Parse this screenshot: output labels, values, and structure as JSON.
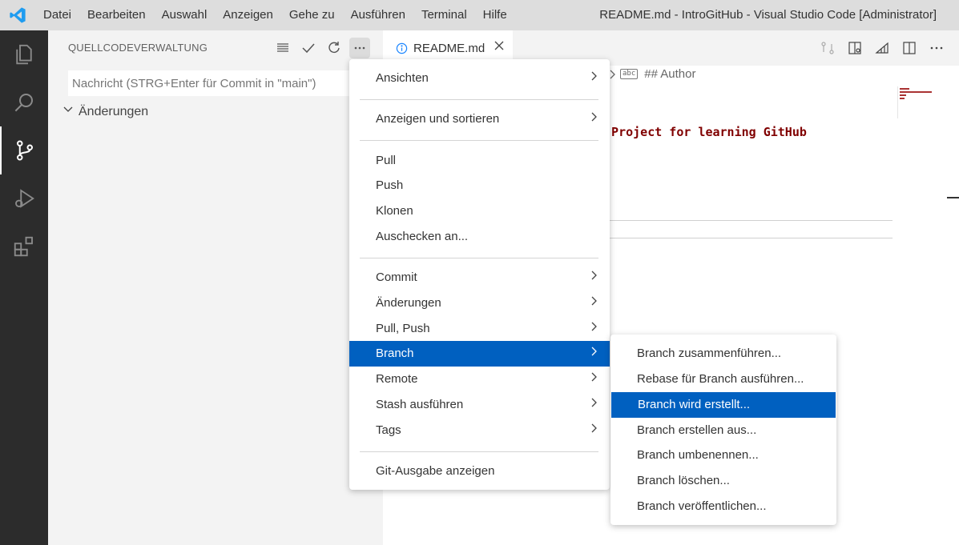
{
  "titlebar": {
    "menu": [
      "Datei",
      "Bearbeiten",
      "Auswahl",
      "Anzeigen",
      "Gehe zu",
      "Ausführen",
      "Terminal",
      "Hilfe"
    ],
    "window_title": "README.md - IntroGitHub - Visual Studio Code [Administrator]"
  },
  "sidebar": {
    "header": "QUELLCODEVERWALTUNG",
    "commit_placeholder": "Nachricht (STRG+Enter für Commit in \"main\")",
    "changes_label": "Änderungen"
  },
  "editor": {
    "tab_label": "README.md",
    "breadcrumb": "## Author",
    "breadcrumb_badge": "abc",
    "code_visible": "e Project for learning GitHub"
  },
  "main_menu": {
    "items": [
      {
        "label": "Ansichten",
        "submenu": true
      },
      {
        "label": "Anzeigen und sortieren",
        "submenu": true
      },
      {
        "label": "Pull",
        "submenu": false
      },
      {
        "label": "Push",
        "submenu": false
      },
      {
        "label": "Klonen",
        "submenu": false
      },
      {
        "label": "Auschecken an...",
        "submenu": false
      },
      {
        "label": "Commit",
        "submenu": true
      },
      {
        "label": "Änderungen",
        "submenu": true
      },
      {
        "label": "Pull, Push",
        "submenu": true
      },
      {
        "label": "Branch",
        "submenu": true,
        "highlighted": true
      },
      {
        "label": "Remote",
        "submenu": true
      },
      {
        "label": "Stash ausführen",
        "submenu": true
      },
      {
        "label": "Tags",
        "submenu": true
      },
      {
        "label": "Git-Ausgabe anzeigen",
        "submenu": false
      }
    ]
  },
  "branch_submenu": {
    "items": [
      {
        "label": "Branch zusammenführen..."
      },
      {
        "label": "Rebase für Branch ausführen..."
      },
      {
        "label": "Branch wird erstellt...",
        "highlighted": true
      },
      {
        "label": "Branch erstellen aus..."
      },
      {
        "label": "Branch umbenennen..."
      },
      {
        "label": "Branch löschen..."
      },
      {
        "label": "Branch veröffentlichen..."
      }
    ]
  },
  "colors": {
    "highlight": "#0060c0",
    "activity_bar": "#2c2c2c",
    "sidebar": "#f3f3f3",
    "titlebar": "#dddddd",
    "vscode_blue": "#1f9cf0",
    "code_text": "#800000"
  }
}
